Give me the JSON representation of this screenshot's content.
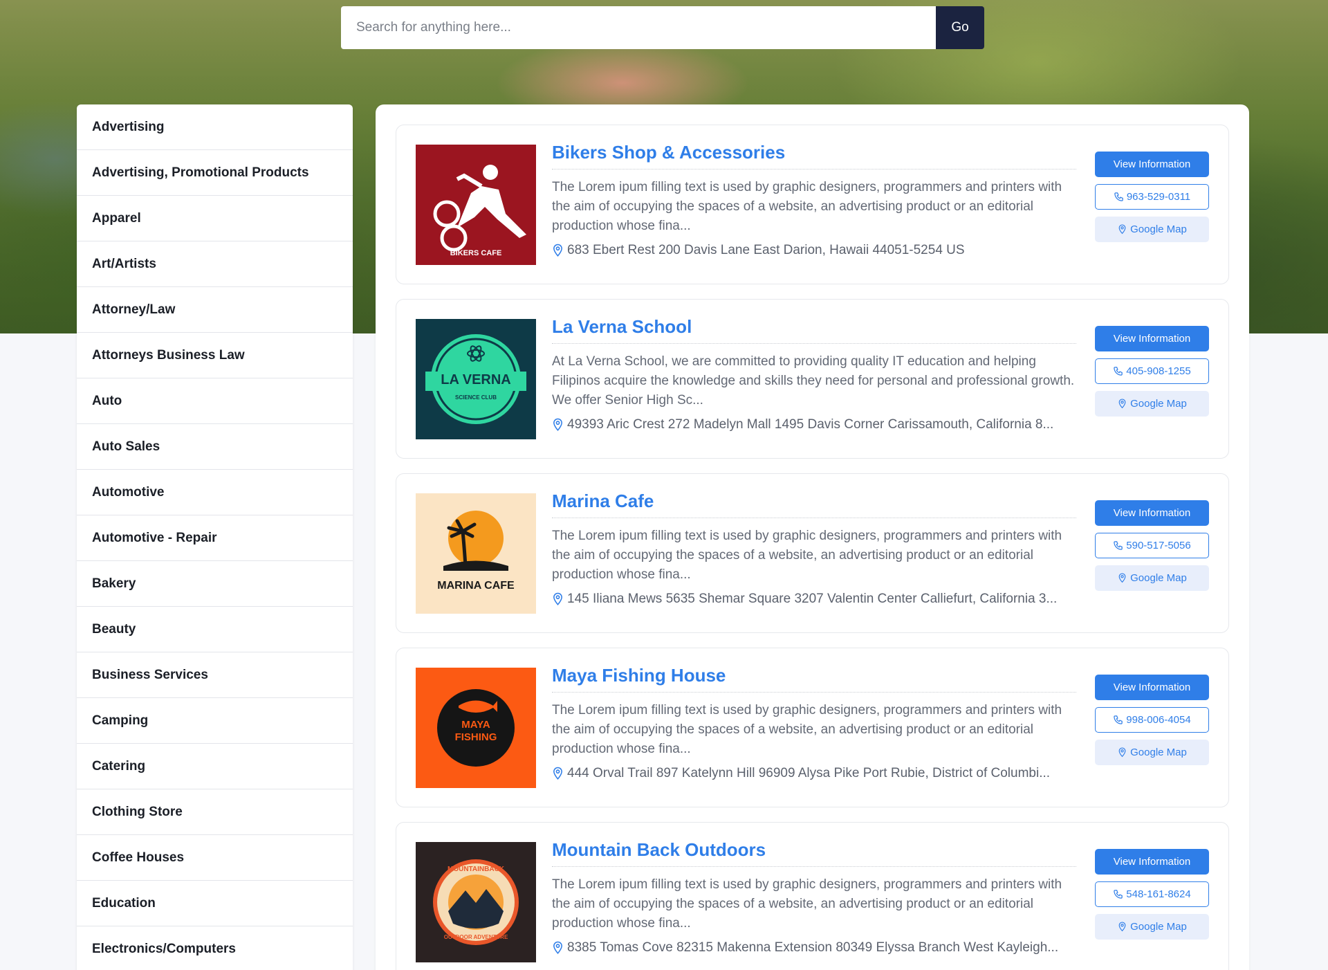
{
  "search": {
    "placeholder": "Search for anything here...",
    "button_label": "Go"
  },
  "categories": [
    "Advertising",
    "Advertising, Promotional Products",
    "Apparel",
    "Art/Artists",
    "Attorney/Law",
    "Attorneys Business Law",
    "Auto",
    "Auto Sales",
    "Automotive",
    "Automotive - Repair",
    "Bakery",
    "Beauty",
    "Business Services",
    "Camping",
    "Catering",
    "Clothing Store",
    "Coffee Houses",
    "Education",
    "Electronics/Computers"
  ],
  "listings": [
    {
      "title": "Bikers Shop & Accessories",
      "description": "The Lorem ipum filling text is used by graphic designers, programmers and printers with the aim of occupying the spaces of a website, an advertising product or an editorial production whose fina...",
      "address": "683 Ebert Rest 200 Davis Lane East Darion, Hawaii 44051-5254 US",
      "logo_text": "BIKERS CAFE",
      "phone": "963-529-0311"
    },
    {
      "title": "La Verna School",
      "description": "At La Verna School, we are committed to providing quality IT education and helping Filipinos acquire the knowledge and skills they need for personal and professional growth. We offer Senior High Sc...",
      "address": "49393 Aric Crest 272 Madelyn Mall 1495 Davis Corner Carissamouth, California 8...",
      "logo_text": "LA VERNA",
      "logo_subtext": "SCIENCE CLUB",
      "phone": "405-908-1255"
    },
    {
      "title": "Marina Cafe",
      "description": "The Lorem ipum filling text is used by graphic designers, programmers and printers with the aim of occupying the spaces of a website, an advertising product or an editorial production whose fina...",
      "address": "145 Iliana Mews 5635 Shemar Square 3207 Valentin Center Calliefurt, California 3...",
      "logo_text": "MARINA CAFE",
      "phone": "590-517-5056"
    },
    {
      "title": "Maya Fishing House",
      "description": "The Lorem ipum filling text is used by graphic designers, programmers and printers with the aim of occupying the spaces of a website, an advertising product or an editorial production whose fina...",
      "address": "444 Orval Trail 897 Katelynn Hill 96909 Alysa Pike Port Rubie, District of Columbi...",
      "logo_text": "MAYA",
      "logo_subtext": "FISHING",
      "phone": "998-006-4054"
    },
    {
      "title": "Mountain Back Outdoors",
      "description": "The Lorem ipum filling text is used by graphic designers, programmers and printers with the aim of occupying the spaces of a website, an advertising product or an editorial production whose fina...",
      "address": "8385 Tomas Cove 82315 Makenna Extension 80349 Elyssa Branch West Kayleigh...",
      "logo_text": "MOUNTAINBACK",
      "logo_subtext": "OUTDOOR ADVENTURE",
      "phone": "548-161-8624"
    }
  ],
  "buttons": {
    "view_info": "View Information",
    "map": "Google Map"
  },
  "colors": {
    "accent": "#2f7ee8",
    "search_button": "#1b2340"
  },
  "icons": {
    "phone": "phone-icon",
    "map": "map-pin-icon"
  }
}
